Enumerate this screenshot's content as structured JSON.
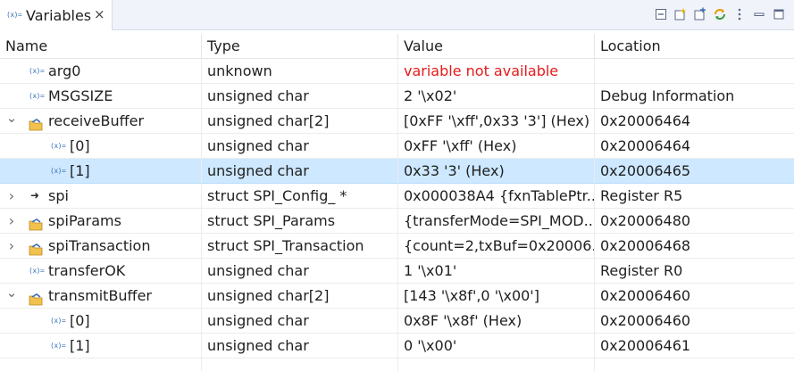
{
  "tab": {
    "title": "Variables",
    "icon": "(x)=",
    "close": "×"
  },
  "toolbar": {
    "buttons": [
      {
        "name": "collapse-all-icon"
      },
      {
        "name": "new-expression-icon"
      },
      {
        "name": "remove-all-icon"
      },
      {
        "name": "refresh-icon"
      },
      {
        "name": "view-menu-icon"
      },
      {
        "name": "minimize-icon"
      },
      {
        "name": "maximize-icon"
      }
    ]
  },
  "columns": {
    "name": "Name",
    "type": "Type",
    "value": "Value",
    "location": "Location"
  },
  "rows": [
    {
      "name": "arg0",
      "type": "unknown",
      "value": "variable not available",
      "location": "",
      "icon": "var",
      "expander": "",
      "level": 0,
      "value_error": true
    },
    {
      "name": "MSGSIZE",
      "type": "unsigned char",
      "value": "2 '\\x02'",
      "location": "Debug Information",
      "icon": "var",
      "expander": "",
      "level": 0
    },
    {
      "name": "receiveBuffer",
      "type": "unsigned char[2]",
      "value": "[0xFF '\\xff',0x33 '3'] (Hex)",
      "location": "0x20006464",
      "icon": "struct",
      "expander": "expanded",
      "level": 0
    },
    {
      "name": "[0]",
      "type": "unsigned char",
      "value": "0xFF '\\xff' (Hex)",
      "location": "0x20006464",
      "icon": "var",
      "expander": "",
      "level": 1
    },
    {
      "name": "[1]",
      "type": "unsigned char",
      "value": "0x33 '3' (Hex)",
      "location": "0x20006465",
      "icon": "var",
      "expander": "",
      "level": 1,
      "selected": true
    },
    {
      "name": "spi",
      "type": "struct SPI_Config_ *",
      "value": "0x000038A4 {fxnTablePtr...",
      "location": "Register R5",
      "icon": "pointer",
      "expander": "collapsed",
      "level": 0
    },
    {
      "name": "spiParams",
      "type": "struct SPI_Params",
      "value": "{transferMode=SPI_MOD...",
      "location": "0x20006480",
      "icon": "struct",
      "expander": "collapsed",
      "level": 0
    },
    {
      "name": "spiTransaction",
      "type": "struct SPI_Transaction",
      "value": "{count=2,txBuf=0x20006...",
      "location": "0x20006468",
      "icon": "struct",
      "expander": "collapsed",
      "level": 0
    },
    {
      "name": "transferOK",
      "type": "unsigned char",
      "value": "1 '\\x01'",
      "location": "Register R0",
      "icon": "var",
      "expander": "",
      "level": 0
    },
    {
      "name": "transmitBuffer",
      "type": "unsigned char[2]",
      "value": "[143 '\\x8f',0 '\\x00']",
      "location": "0x20006460",
      "icon": "struct",
      "expander": "expanded",
      "level": 0
    },
    {
      "name": "[0]",
      "type": "unsigned char",
      "value": "0x8F '\\x8f' (Hex)",
      "location": "0x20006460",
      "icon": "var",
      "expander": "",
      "level": 1
    },
    {
      "name": "[1]",
      "type": "unsigned char",
      "value": "0 '\\x00'",
      "location": "0x20006461",
      "icon": "var",
      "expander": "",
      "level": 1
    }
  ],
  "colors": {
    "selection": "#cde8ff",
    "error_text": "#e51a1a",
    "icon_blue": "#3b6fb6"
  }
}
